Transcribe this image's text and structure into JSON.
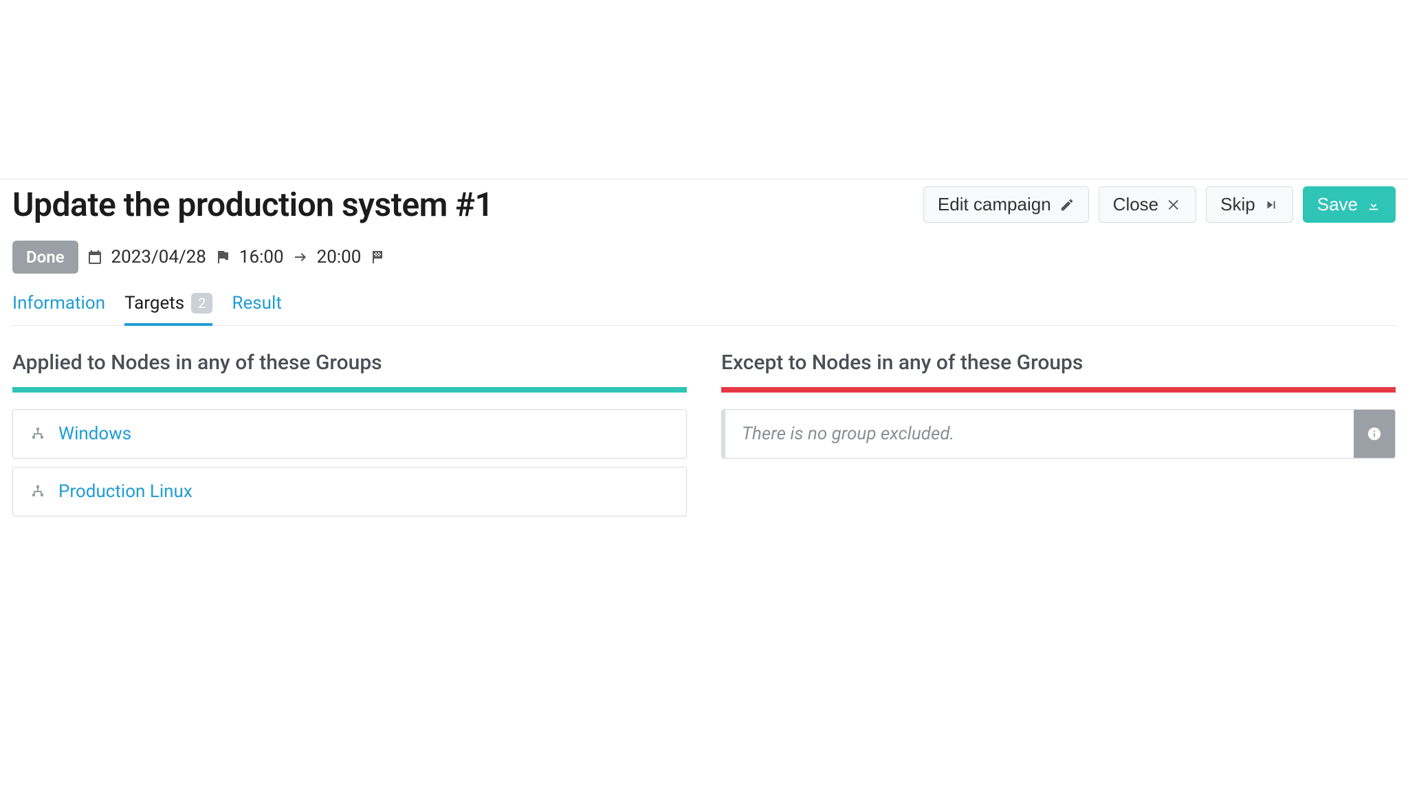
{
  "header": {
    "title": "Update the production system #1",
    "buttons": {
      "edit": "Edit campaign",
      "close": "Close",
      "skip": "Skip",
      "save": "Save"
    }
  },
  "schedule": {
    "status": "Done",
    "date": "2023/04/28",
    "start_time": "16:00",
    "end_time": "20:00"
  },
  "tabs": {
    "information": "Information",
    "targets": {
      "label": "Targets",
      "count": "2"
    },
    "result": "Result"
  },
  "targets": {
    "included": {
      "heading": "Applied to Nodes in any of these Groups",
      "groups": [
        "Windows",
        "Production Linux"
      ]
    },
    "excluded": {
      "heading": "Except to Nodes in any of these Groups",
      "empty_message": "There is no group excluded."
    }
  }
}
